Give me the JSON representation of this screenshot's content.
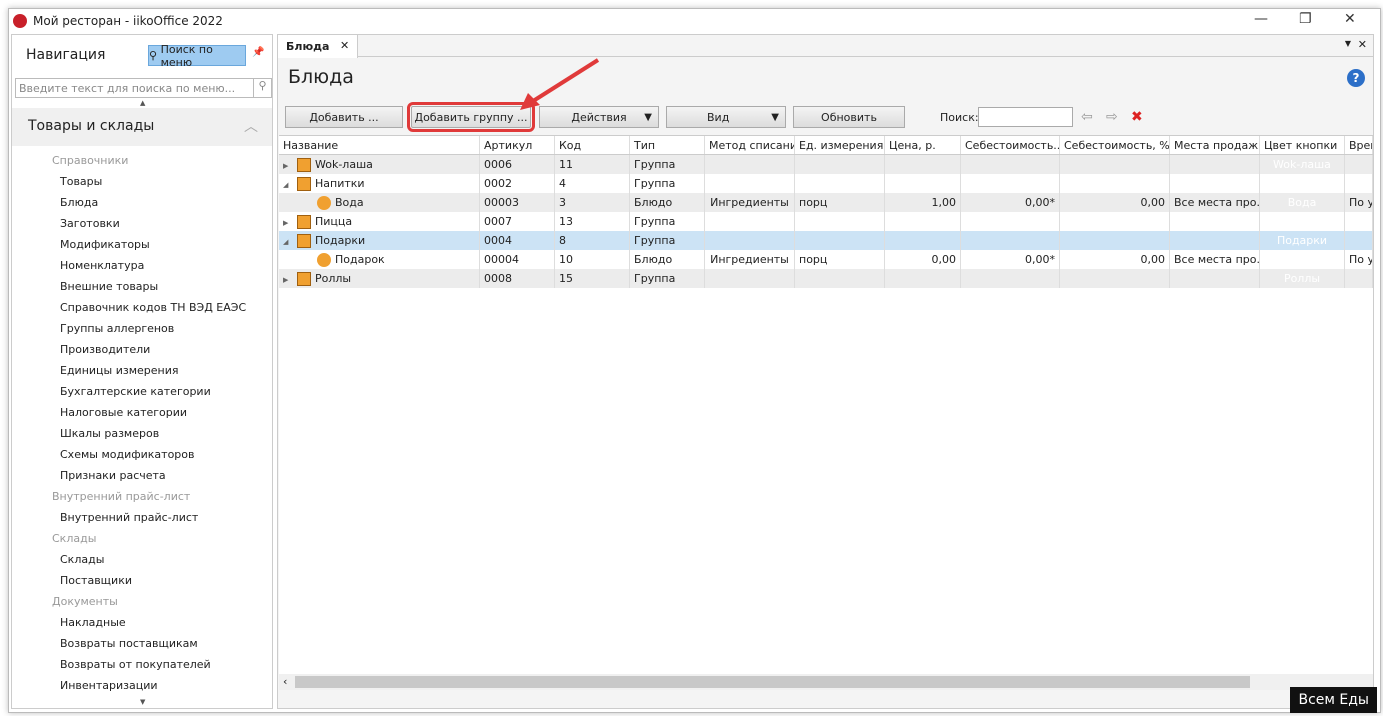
{
  "window": {
    "title": "Мой ресторан - iikoOffice 2022",
    "min": "—",
    "max": "❐",
    "close": "✕"
  },
  "nav": {
    "title": "Навигация",
    "search_btn": "Поиск по меню",
    "search_placeholder": "Введите текст для поиска по меню...",
    "section": "Товары и склады",
    "items": [
      {
        "type": "cat",
        "label": "Справочники"
      },
      {
        "type": "itm",
        "label": "Товары"
      },
      {
        "type": "itm",
        "label": "Блюда"
      },
      {
        "type": "itm",
        "label": "Заготовки"
      },
      {
        "type": "itm",
        "label": "Модификаторы"
      },
      {
        "type": "itm",
        "label": "Номенклатура"
      },
      {
        "type": "itm",
        "label": "Внешние товары"
      },
      {
        "type": "itm",
        "label": "Справочник кодов ТН ВЭД ЕАЭС"
      },
      {
        "type": "itm",
        "label": "Группы аллергенов"
      },
      {
        "type": "itm",
        "label": "Производители"
      },
      {
        "type": "itm",
        "label": "Единицы измерения"
      },
      {
        "type": "itm",
        "label": "Бухгалтерские категории"
      },
      {
        "type": "itm",
        "label": "Налоговые категории"
      },
      {
        "type": "itm",
        "label": "Шкалы размеров"
      },
      {
        "type": "itm",
        "label": "Схемы модификаторов"
      },
      {
        "type": "itm",
        "label": "Признаки расчета"
      },
      {
        "type": "cat",
        "label": "Внутренний прайс-лист"
      },
      {
        "type": "itm",
        "label": "Внутренний прайс-лист"
      },
      {
        "type": "cat",
        "label": "Склады"
      },
      {
        "type": "itm",
        "label": "Склады"
      },
      {
        "type": "itm",
        "label": "Поставщики"
      },
      {
        "type": "cat",
        "label": "Документы"
      },
      {
        "type": "itm",
        "label": "Накладные"
      },
      {
        "type": "itm",
        "label": "Возвраты поставщикам"
      },
      {
        "type": "itm",
        "label": "Возвраты от покупателей"
      },
      {
        "type": "itm",
        "label": "Инвентаризации"
      }
    ]
  },
  "tab": {
    "label": "Блюда",
    "close": "✕"
  },
  "page_title": "Блюда",
  "toolbar": {
    "add": "Добавить ...",
    "add_group": "Добавить группу ...",
    "actions": "Действия",
    "view": "Вид",
    "refresh": "Обновить",
    "search_label": "Поиск:",
    "search_value": ""
  },
  "columns": [
    "Название",
    "Артикул",
    "Код",
    "Тип",
    "Метод списания",
    "Ед. измерения",
    "Цена, р.",
    "Себестоимость...",
    "Себестоимость, %",
    "Места продаж",
    "Цвет кнопки",
    "Врем"
  ],
  "rows": [
    {
      "kind": "group",
      "expanded": false,
      "cells": [
        "Wok-лаша",
        "0006",
        "11",
        "Группа",
        "",
        "",
        "",
        "",
        "",
        "",
        "Wok-лаша",
        ""
      ]
    },
    {
      "kind": "group",
      "expanded": true,
      "cells": [
        "Напитки",
        "0002",
        "4",
        "Группа",
        "",
        "",
        "",
        "",
        "",
        "",
        "",
        ""
      ]
    },
    {
      "kind": "dish",
      "cells": [
        "Вода",
        "00003",
        "3",
        "Блюдо",
        "Ингредиенты",
        "порц",
        "1,00",
        "0,00*",
        "0,00",
        "Все места про...",
        "Вода",
        "По у"
      ]
    },
    {
      "kind": "group",
      "expanded": false,
      "cells": [
        "Пицца",
        "0007",
        "13",
        "Группа",
        "",
        "",
        "",
        "",
        "",
        "",
        "",
        ""
      ]
    },
    {
      "kind": "group",
      "expanded": true,
      "selected": true,
      "cells": [
        "Подарки",
        "0004",
        "8",
        "Группа",
        "",
        "",
        "",
        "",
        "",
        "",
        "Подарки",
        ""
      ]
    },
    {
      "kind": "dish",
      "cells": [
        "Подарок",
        "00004",
        "10",
        "Блюдо",
        "Ингредиенты",
        "порц",
        "0,00",
        "0,00*",
        "0,00",
        "Все места про...",
        "",
        "По у"
      ]
    },
    {
      "kind": "group",
      "expanded": false,
      "cells": [
        "Роллы",
        "0008",
        "15",
        "Группа",
        "",
        "",
        "",
        "",
        "",
        "",
        "Роллы",
        ""
      ]
    }
  ],
  "badge": "Всем Еды"
}
